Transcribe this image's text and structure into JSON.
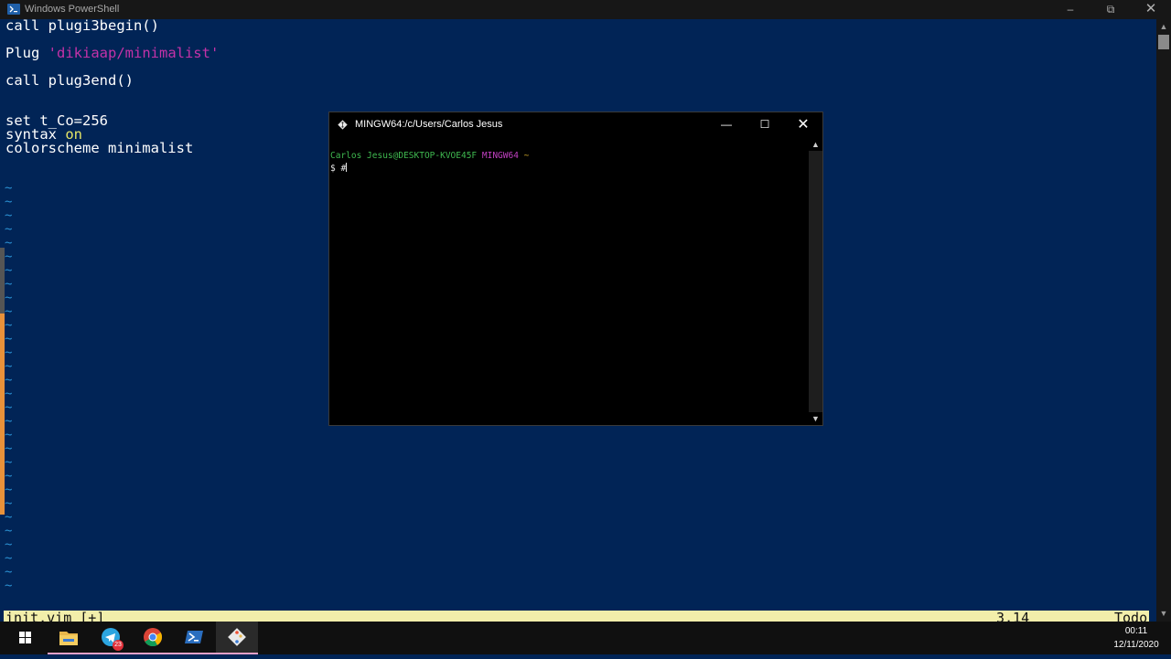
{
  "powershell": {
    "title": "Windows PowerShell",
    "controls": {
      "minimize": "–",
      "maximize": "⧉",
      "close": "✕"
    }
  },
  "editor": {
    "lines": [
      {
        "text": "call plugi3begin()"
      },
      {
        "prefix": "Plug ",
        "string": "'dikiaap/minimalist'"
      },
      {
        "text": "call plug3end()"
      },
      {
        "text": "set t_Co=256"
      },
      {
        "prefix": "syntax ",
        "keyword": "on"
      },
      {
        "text": "colorscheme minimalist"
      }
    ],
    "tilde": "~",
    "status_file": "init.vim [+]",
    "status_position": "3,14",
    "status_scroll": "Todo",
    "cmdline": ":"
  },
  "mingw": {
    "title": "MINGW64:/c/Users/Carlos Jesus",
    "prompt_user": "Carlos Jesus@DESKTOP-KVOE45F",
    "prompt_system": "MINGW64",
    "prompt_path": "~",
    "command": "$ #",
    "controls": {
      "minimize": "—",
      "maximize": "☐",
      "close": "✕"
    }
  },
  "taskbar": {
    "apps": [
      "windows-start",
      "file-explorer",
      "telegram",
      "chrome",
      "powershell",
      "git-bash"
    ],
    "telegram_badge": "23",
    "clock_time": "00:11",
    "clock_date": "12/11/2020"
  },
  "colors": {
    "powershell_bg": "#012456",
    "vim_string": "#c532a8",
    "vim_keyword": "#e6e666",
    "vim_tilde": "#2a8fd0",
    "statusline_bg": "#f2eeaa",
    "prompt_green": "#3fb950",
    "prompt_magenta": "#c040c0",
    "prompt_yellow": "#c9a227"
  }
}
